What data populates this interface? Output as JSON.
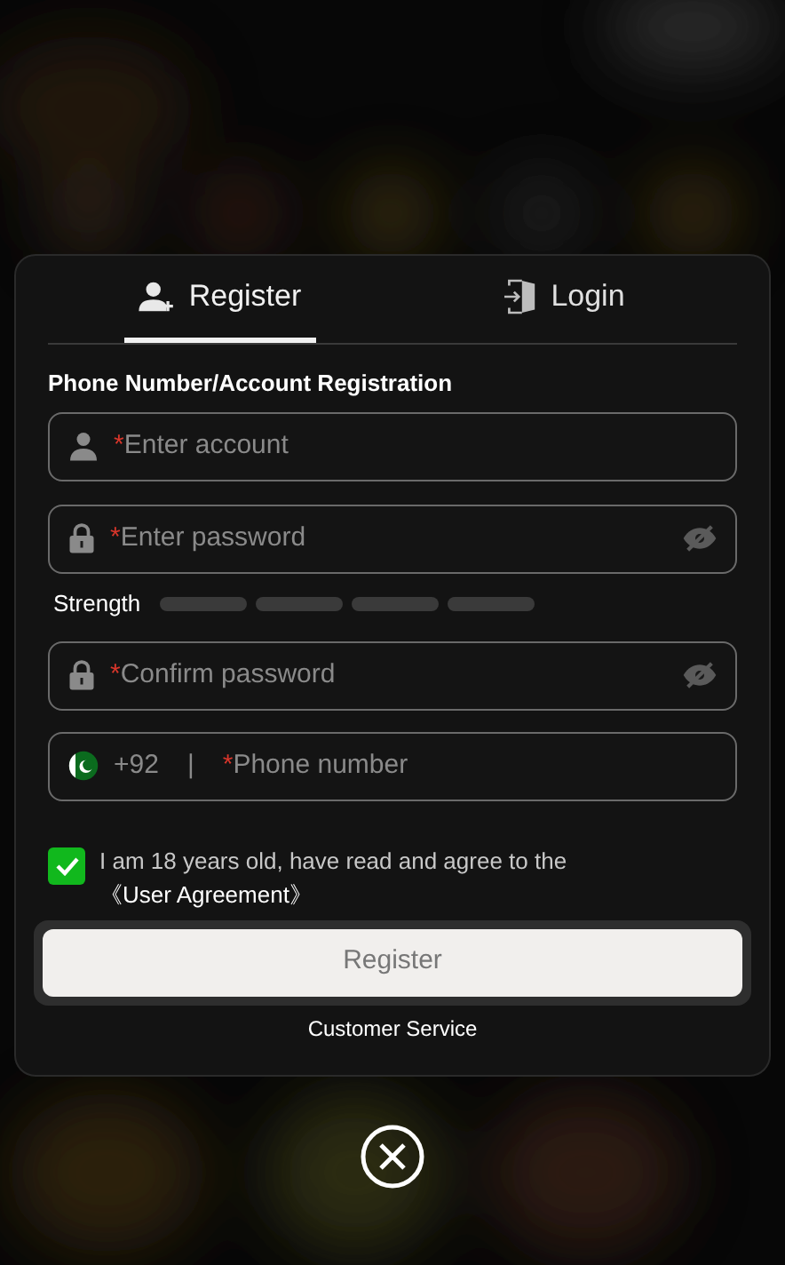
{
  "tabs": [
    {
      "label": "Register",
      "selected": true
    },
    {
      "label": "Login",
      "selected": false
    }
  ],
  "section_title": "Phone Number/Account Registration",
  "fields": [
    {
      "kind": "text",
      "required_mark": "*",
      "placeholder": "Enter account"
    },
    {
      "kind": "password",
      "required_mark": "*",
      "placeholder": "Enter password"
    },
    {
      "kind": "strength",
      "label": "Strength",
      "segments": [
        {
          "filled": false
        },
        {
          "filled": false
        },
        {
          "filled": false
        },
        {
          "filled": false
        }
      ]
    },
    {
      "kind": "password",
      "required_mark": "*",
      "placeholder": "Confirm password"
    },
    {
      "kind": "phone",
      "code": "+92",
      "separator": "|",
      "required_mark": "*",
      "placeholder": "Phone number"
    }
  ],
  "agreement": {
    "checked": true,
    "text": "I am 18 years old, have read and agree to the ",
    "link": "《User Agreement》"
  },
  "submit": {
    "label": "Register"
  },
  "customer_service": "Customer Service"
}
